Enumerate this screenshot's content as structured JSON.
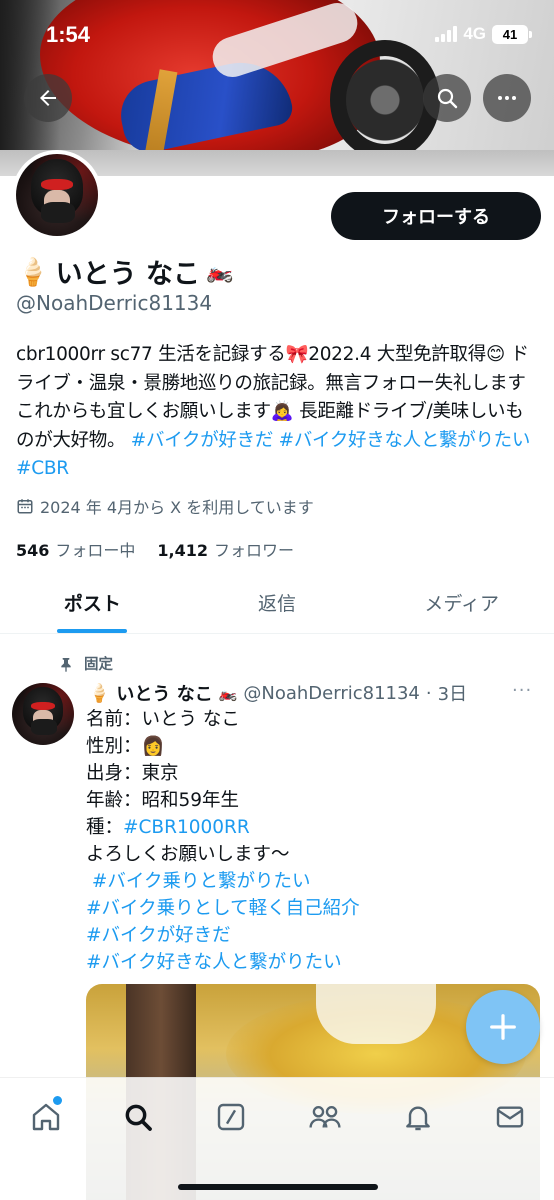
{
  "status_bar": {
    "time": "1:54",
    "network": "4G",
    "battery": "41"
  },
  "header": {
    "follow_label": "フォローする"
  },
  "profile": {
    "display_name": "いとう なこ",
    "name_emoji_left": "🍦",
    "name_emoji_right": "🏍️",
    "handle": "@NoahDerric81134",
    "bio_text": "cbr1000rr sc77 生活を記録する🎀2022.4 大型免許取得😊 ドライブ・温泉・景勝地巡りの旅記録。無言フォロー失礼します これからも宜しくお願いします🙇‍♀️ 長距離ドライブ/美味しいものが大好物。",
    "bio_tags": [
      "#バイクが好きだ",
      "#バイク好きな人と繋がりたい",
      "#CBR"
    ],
    "joined": "2024 年 4月から X を利用しています",
    "following_count": "546",
    "following_label": "フォロー中",
    "followers_count": "1,412",
    "followers_label": "フォロワー"
  },
  "tabs": [
    {
      "label": "ポスト",
      "active": true
    },
    {
      "label": "返信",
      "active": false
    },
    {
      "label": "メディア",
      "active": false
    }
  ],
  "post": {
    "pinned_label": "固定",
    "author_emoji_left": "🍦",
    "author_name": "いとう なこ",
    "author_emoji_right": "🏍️",
    "handle": "@NoahDerric81134",
    "separator": "·",
    "time": "3日",
    "more": "···",
    "lines": [
      "名前：いとう なこ",
      "性別：👩",
      "出身：東京",
      "年齢：昭和59年生",
      "種：",
      "よろしくお願いします〜"
    ],
    "cbr_tag": "#CBR1000RR",
    "tags": [
      " #バイク乗りと繋がりたい",
      "#バイク乗りとして軽く自己紹介",
      "#バイクが好きだ",
      "#バイク好きな人と繋がりたい"
    ]
  },
  "colors": {
    "accent": "#1d9bf0",
    "text": "#0f1419",
    "muted": "#536471",
    "fab": "#7fc4f5"
  },
  "icons": {
    "back": "back-arrow-icon",
    "search": "search-icon",
    "more": "more-dots-icon",
    "calendar": "calendar-icon",
    "pin": "pin-icon",
    "compose": "plus-icon",
    "nav": [
      "home-icon",
      "search-icon",
      "grok-icon",
      "communities-icon",
      "notifications-icon",
      "messages-icon"
    ]
  }
}
